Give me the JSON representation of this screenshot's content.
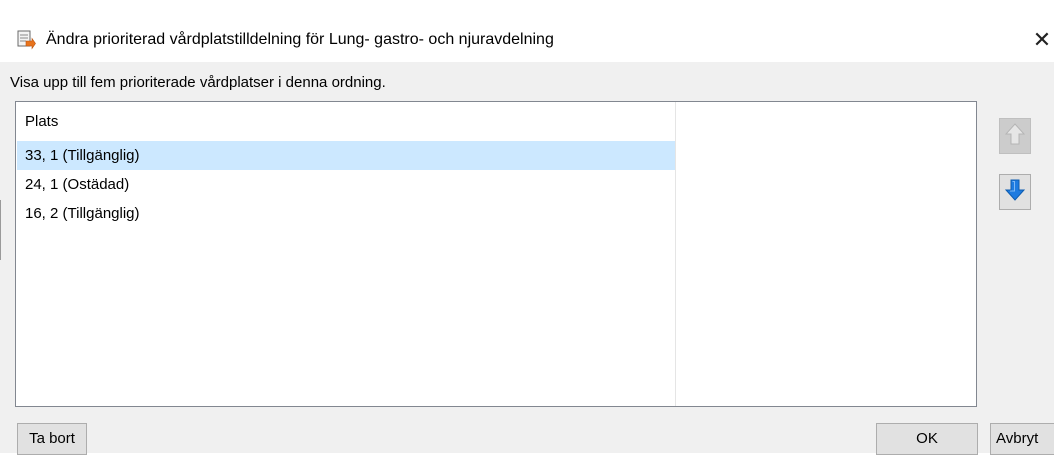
{
  "window": {
    "title": "Ändra prioriterad vårdplatstilldelning för Lung- gastro- och njuravdelning",
    "close_glyph": "✕",
    "icon": "app-document-arrow-icon"
  },
  "instruction": "Visa upp till fem prioriterade vårdplatser i denna ordning.",
  "list": {
    "column_header": "Plats",
    "rows": [
      {
        "label": "33, 1 (Tillgänglig)",
        "selected": true
      },
      {
        "label": "24, 1 (Ostädad)",
        "selected": false
      },
      {
        "label": "16, 2 (Tillgänglig)",
        "selected": false
      }
    ]
  },
  "side_buttons": {
    "up": {
      "icon": "arrow-up-icon",
      "enabled": false
    },
    "down": {
      "icon": "arrow-down-icon",
      "enabled": true
    }
  },
  "buttons": {
    "remove": "Ta bort",
    "ok": "OK",
    "cancel": "Avbryt"
  },
  "colors": {
    "selection": "#cce8ff",
    "arrow_active": "#1e7be0",
    "arrow_disabled": "#e6e6e6"
  }
}
